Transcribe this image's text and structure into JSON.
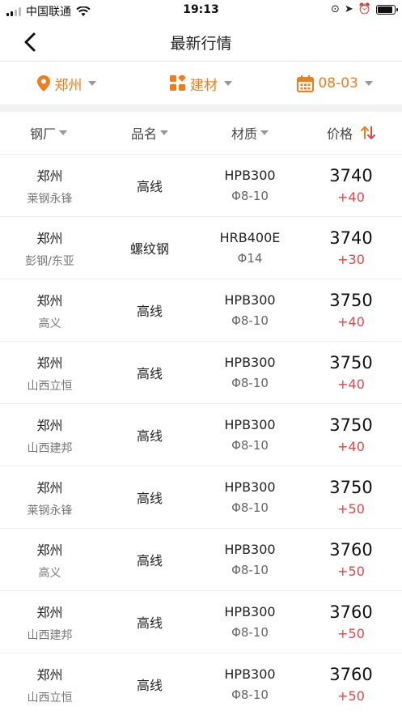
{
  "status_bar": {
    "carrier": "中国联通",
    "time": "19:13"
  },
  "nav": {
    "title": "最新行情"
  },
  "filters": {
    "city": "郑州",
    "category": "建材",
    "date": "08-03"
  },
  "table_header": {
    "mill": "钢厂",
    "product": "品名",
    "material": "材质",
    "price": "价格"
  },
  "rows": [
    {
      "city": "郑州",
      "mill": "莱钢永锋",
      "product": "高线",
      "grade": "HPB300",
      "spec": "Φ8-10",
      "price": "3740",
      "change": "+40"
    },
    {
      "city": "郑州",
      "mill": "彭钢/东亚",
      "product": "螺纹钢",
      "grade": "HRB400E",
      "spec": "Φ14",
      "price": "3740",
      "change": "+30"
    },
    {
      "city": "郑州",
      "mill": "高义",
      "product": "高线",
      "grade": "HPB300",
      "spec": "Φ8-10",
      "price": "3750",
      "change": "+40"
    },
    {
      "city": "郑州",
      "mill": "山西立恒",
      "product": "高线",
      "grade": "HPB300",
      "spec": "Φ8-10",
      "price": "3750",
      "change": "+40"
    },
    {
      "city": "郑州",
      "mill": "山西建邦",
      "product": "高线",
      "grade": "HPB300",
      "spec": "Φ8-10",
      "price": "3750",
      "change": "+40"
    },
    {
      "city": "郑州",
      "mill": "莱钢永锋",
      "product": "高线",
      "grade": "HPB300",
      "spec": "Φ8-10",
      "price": "3750",
      "change": "+50"
    },
    {
      "city": "郑州",
      "mill": "高义",
      "product": "高线",
      "grade": "HPB300",
      "spec": "Φ8-10",
      "price": "3760",
      "change": "+50"
    },
    {
      "city": "郑州",
      "mill": "山西建邦",
      "product": "高线",
      "grade": "HPB300",
      "spec": "Φ8-10",
      "price": "3760",
      "change": "+50"
    },
    {
      "city": "郑州",
      "mill": "山西立恒",
      "product": "高线",
      "grade": "HPB300",
      "spec": "Φ8-10",
      "price": "3760",
      "change": "+50"
    }
  ],
  "colors": {
    "accent": "#f07d1a",
    "rise": "#e64545"
  },
  "icons": [
    "back-arrow-icon",
    "location-pin-icon",
    "category-grid-icon",
    "calendar-icon",
    "sort-icon",
    "wifi-icon",
    "signal-icon",
    "battery-icon"
  ]
}
